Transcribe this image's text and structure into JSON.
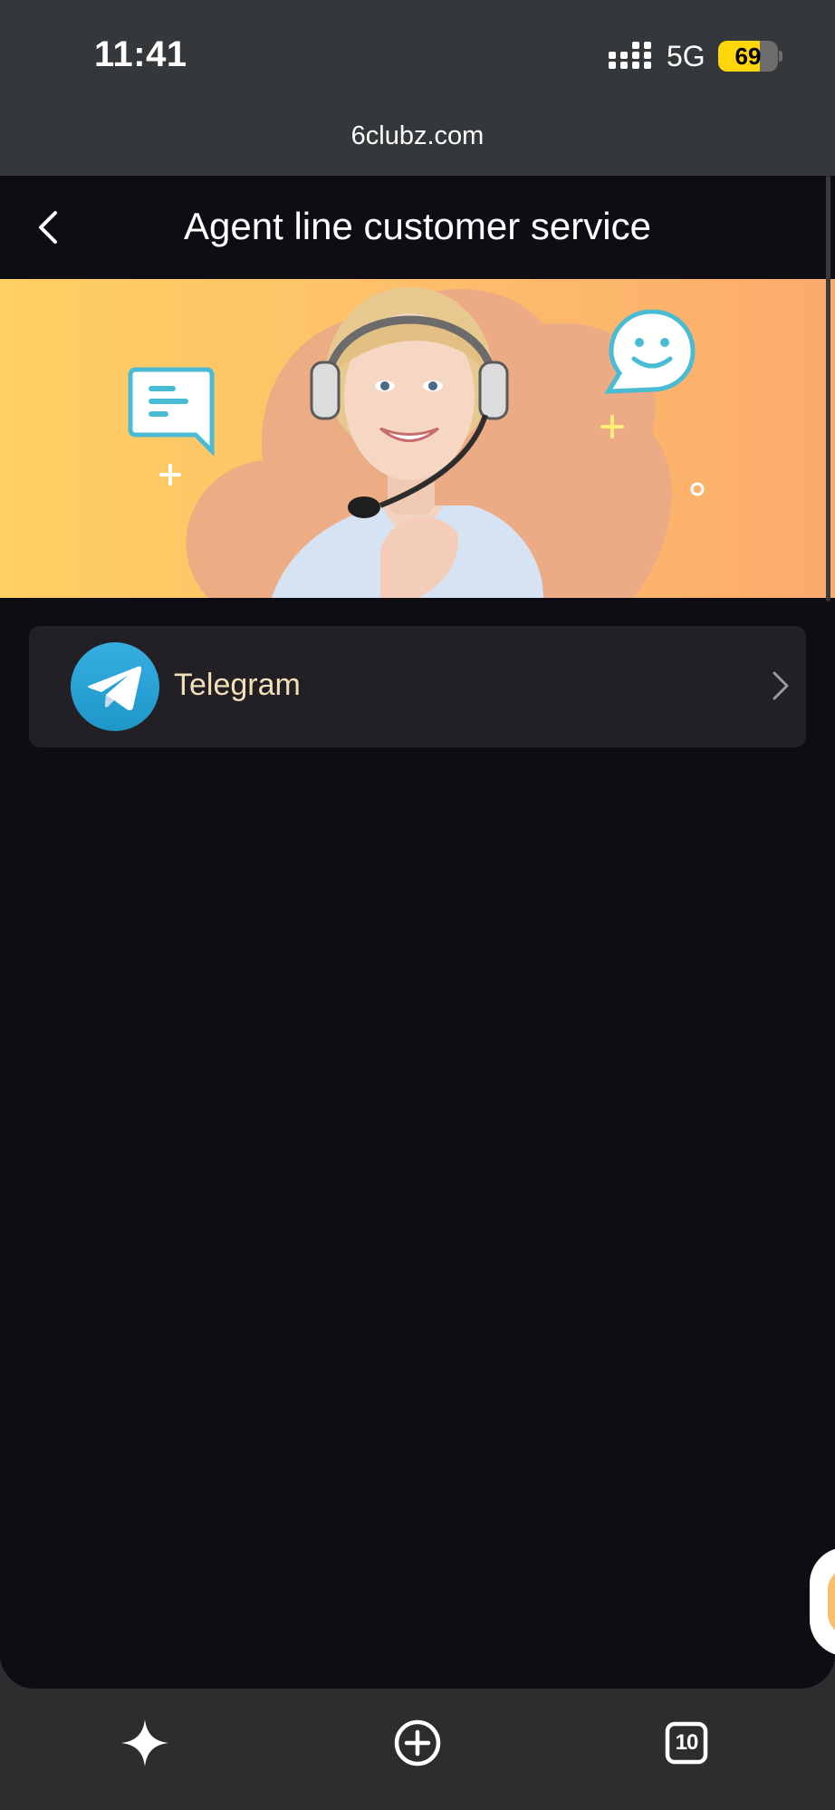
{
  "status_bar": {
    "time": "11:41",
    "network": "5G",
    "battery_level": "69",
    "battery_fraction": 0.69
  },
  "browser": {
    "url": "6clubz.com",
    "tab_count": "10"
  },
  "page": {
    "title": "Agent line customer service",
    "back_icon": "chevron-left-icon"
  },
  "banner": {
    "image": "customer-service-agent-with-headset"
  },
  "services": [
    {
      "label": "Telegram",
      "icon": "telegram-icon"
    }
  ],
  "toolbar": {
    "icons": [
      "sparkle-icon",
      "plus-circle-icon",
      "tabs-icon"
    ]
  },
  "colors": {
    "page_bg": "#0f0d14",
    "item_bg": "#232025",
    "item_text": "#f3dfb8",
    "chrome_bg": "#35383a",
    "battery": "#ffd60a"
  }
}
